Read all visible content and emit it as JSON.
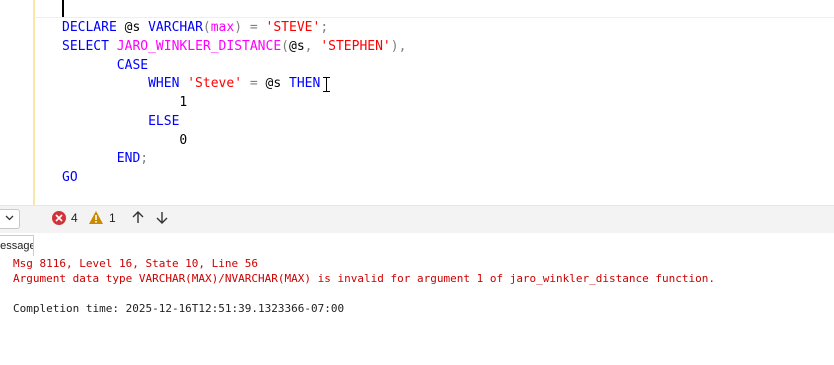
{
  "editor": {
    "lines": [
      {
        "tokens": [
          {
            "t": "DECLARE",
            "c": "kw"
          },
          {
            "t": " @s ",
            "c": "txt"
          },
          {
            "t": "VARCHAR",
            "c": "kw"
          },
          {
            "t": "(",
            "c": "op"
          },
          {
            "t": "max",
            "c": "fn"
          },
          {
            "t": ")",
            "c": "op"
          },
          {
            "t": " = ",
            "c": "op"
          },
          {
            "t": "'STEVE'",
            "c": "str"
          },
          {
            "t": ";",
            "c": "op"
          }
        ]
      },
      {
        "tokens": [
          {
            "t": "SELECT ",
            "c": "kw"
          },
          {
            "t": "JARO_WINKLER_DISTANCE",
            "c": "fn"
          },
          {
            "t": "(",
            "c": "op"
          },
          {
            "t": "@s",
            "c": "txt"
          },
          {
            "t": ", ",
            "c": "op"
          },
          {
            "t": "'STEPHEN'",
            "c": "str"
          },
          {
            "t": "),",
            "c": "op"
          }
        ]
      },
      {
        "tokens": [
          {
            "t": "       CASE",
            "c": "kw"
          }
        ]
      },
      {
        "tokens": [
          {
            "t": "           WHEN ",
            "c": "kw"
          },
          {
            "t": "'Steve'",
            "c": "str"
          },
          {
            "t": " = ",
            "c": "op"
          },
          {
            "t": "@s ",
            "c": "txt"
          },
          {
            "t": "THEN",
            "c": "kw"
          }
        ]
      },
      {
        "tokens": [
          {
            "t": "               1",
            "c": "txt"
          }
        ]
      },
      {
        "tokens": [
          {
            "t": "           ELSE",
            "c": "kw"
          }
        ]
      },
      {
        "tokens": [
          {
            "t": "               0",
            "c": "txt"
          }
        ]
      },
      {
        "tokens": [
          {
            "t": "       END",
            "c": "kw"
          },
          {
            "t": ";",
            "c": "op"
          }
        ]
      },
      {
        "tokens": [
          {
            "t": "GO",
            "c": "kw"
          }
        ]
      }
    ]
  },
  "status": {
    "error_count": "4",
    "warning_count": "1"
  },
  "results": {
    "tab_label": "Messages"
  },
  "messages": {
    "line1": "Msg 8116, Level 16, State 10, Line 56",
    "line2": "Argument data type VARCHAR(MAX)/NVARCHAR(MAX) is invalid for argument 1 of jaro_winkler_distance function.",
    "line3": "Completion time: 2025-12-16T12:51:39.1323366-07:00"
  },
  "colors": {
    "keyword": "#0000ff",
    "function": "#ff00ff",
    "string": "#ff0000",
    "operator": "#808080",
    "error_text": "#cc0000"
  }
}
